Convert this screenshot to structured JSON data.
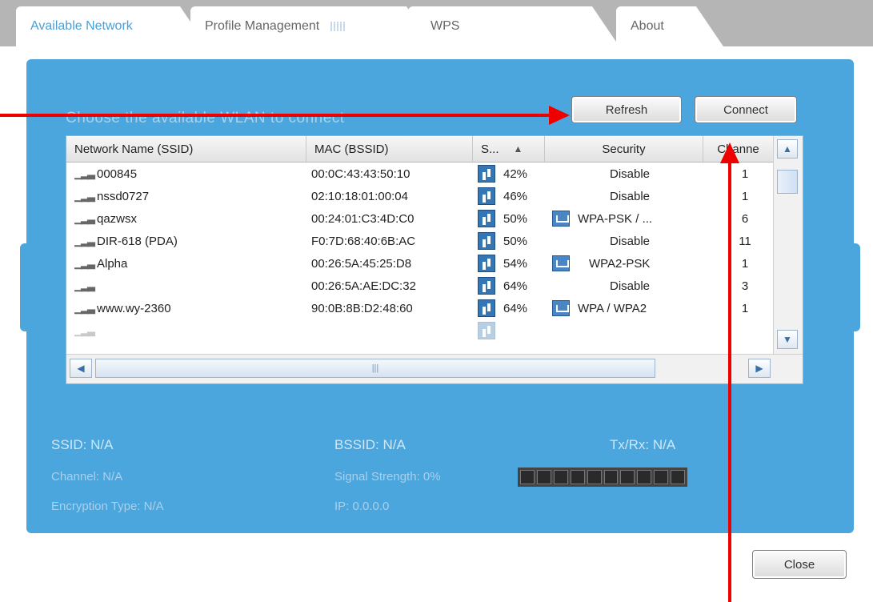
{
  "tabs": [
    {
      "label": "Available Network",
      "active": true
    },
    {
      "label": "Profile Management",
      "active": false
    },
    {
      "label": "WPS",
      "active": false
    },
    {
      "label": "About",
      "active": false
    }
  ],
  "main": {
    "instruction": "Choose the available WLAN to connect",
    "refresh_label": "Refresh",
    "connect_label": "Connect"
  },
  "table": {
    "headers": [
      "Network Name (SSID)",
      "MAC (BSSID)",
      "S...",
      "Security",
      "Channe"
    ],
    "rows": [
      {
        "ssid": "000845",
        "mac": "00:0C:43:43:50:10",
        "signal": "42%",
        "security": "Disable",
        "channel": "1",
        "secure": false
      },
      {
        "ssid": "nssd0727",
        "mac": "02:10:18:01:00:04",
        "signal": "46%",
        "security": "Disable",
        "channel": "1",
        "secure": false
      },
      {
        "ssid": "qazwsx",
        "mac": "00:24:01:C3:4D:C0",
        "signal": "50%",
        "security": "WPA-PSK / ...",
        "channel": "6",
        "secure": true
      },
      {
        "ssid": "DIR-618 (PDA)",
        "mac": "F0:7D:68:40:6B:AC",
        "signal": "50%",
        "security": "Disable",
        "channel": "11",
        "secure": false
      },
      {
        "ssid": "Alpha",
        "mac": "00:26:5A:45:25:D8",
        "signal": "54%",
        "security": "WPA2-PSK",
        "channel": "1",
        "secure": true
      },
      {
        "ssid": "",
        "mac": "00:26:5A:AE:DC:32",
        "signal": "64%",
        "security": "Disable",
        "channel": "3",
        "secure": false
      },
      {
        "ssid": "www.wy-2360",
        "mac": "90:0B:8B:D2:48:60",
        "signal": "64%",
        "security": "WPA / WPA2",
        "channel": "1",
        "secure": true
      }
    ]
  },
  "status": {
    "ssid": "SSID: N/A",
    "bssid": "BSSID: N/A",
    "txrx": "Tx/Rx: N/A",
    "channel": "Channel: N/A",
    "signal": "Signal Strength: 0%",
    "signal_strength_percent": 0,
    "encryption": "Encryption Type: N/A",
    "ip": "IP: 0.0.0.0"
  },
  "footer": {
    "close_label": "Close"
  },
  "colors": {
    "panel_bg": "#4aa6dc",
    "annotation_arrow": "#ee0000"
  }
}
